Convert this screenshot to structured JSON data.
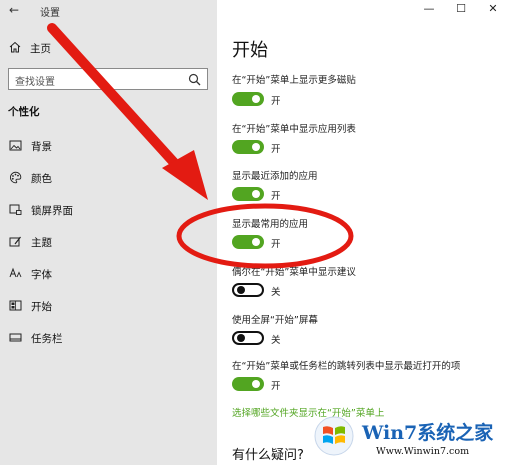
{
  "window": {
    "title": "设置",
    "back_glyph": "←",
    "minimize_glyph": "—",
    "maximize_glyph": "☐",
    "close_glyph": "✕"
  },
  "sidebar": {
    "home_label": "主页",
    "search_placeholder": "查找设置",
    "section_title": "个性化",
    "items": [
      {
        "label": "背景",
        "icon": "image-icon"
      },
      {
        "label": "颜色",
        "icon": "palette-icon"
      },
      {
        "label": "锁屏界面",
        "icon": "lock-screen-icon"
      },
      {
        "label": "主题",
        "icon": "theme-icon"
      },
      {
        "label": "字体",
        "icon": "font-icon"
      },
      {
        "label": "开始",
        "icon": "start-icon"
      },
      {
        "label": "任务栏",
        "icon": "taskbar-icon"
      }
    ]
  },
  "main": {
    "title": "开始",
    "settings": [
      {
        "label": "在“开始”菜单上显示更多磁贴",
        "state": "开",
        "on": true
      },
      {
        "label": "在“开始”菜单中显示应用列表",
        "state": "开",
        "on": true
      },
      {
        "label": "显示最近添加的应用",
        "state": "开",
        "on": true
      },
      {
        "label": "显示最常用的应用",
        "state": "开",
        "on": true
      },
      {
        "label": "偶尔在“开始”菜单中显示建议",
        "state": "关",
        "on": false
      },
      {
        "label": "使用全屏“开始”屏幕",
        "state": "关",
        "on": false
      },
      {
        "label": "在“开始”菜单或任务栏的跳转列表中显示最近打开的项",
        "state": "开",
        "on": true
      }
    ],
    "link_text": "选择哪些文件夹显示在“开始”菜单上",
    "question": "有什么疑问?"
  },
  "colors": {
    "accent": "#52a521",
    "annotation": "#e31b12",
    "sidebar_bg": "#e6e6e6"
  },
  "watermark": {
    "brand": "Win7系统之家",
    "url": "Www.Winwin7.com"
  }
}
